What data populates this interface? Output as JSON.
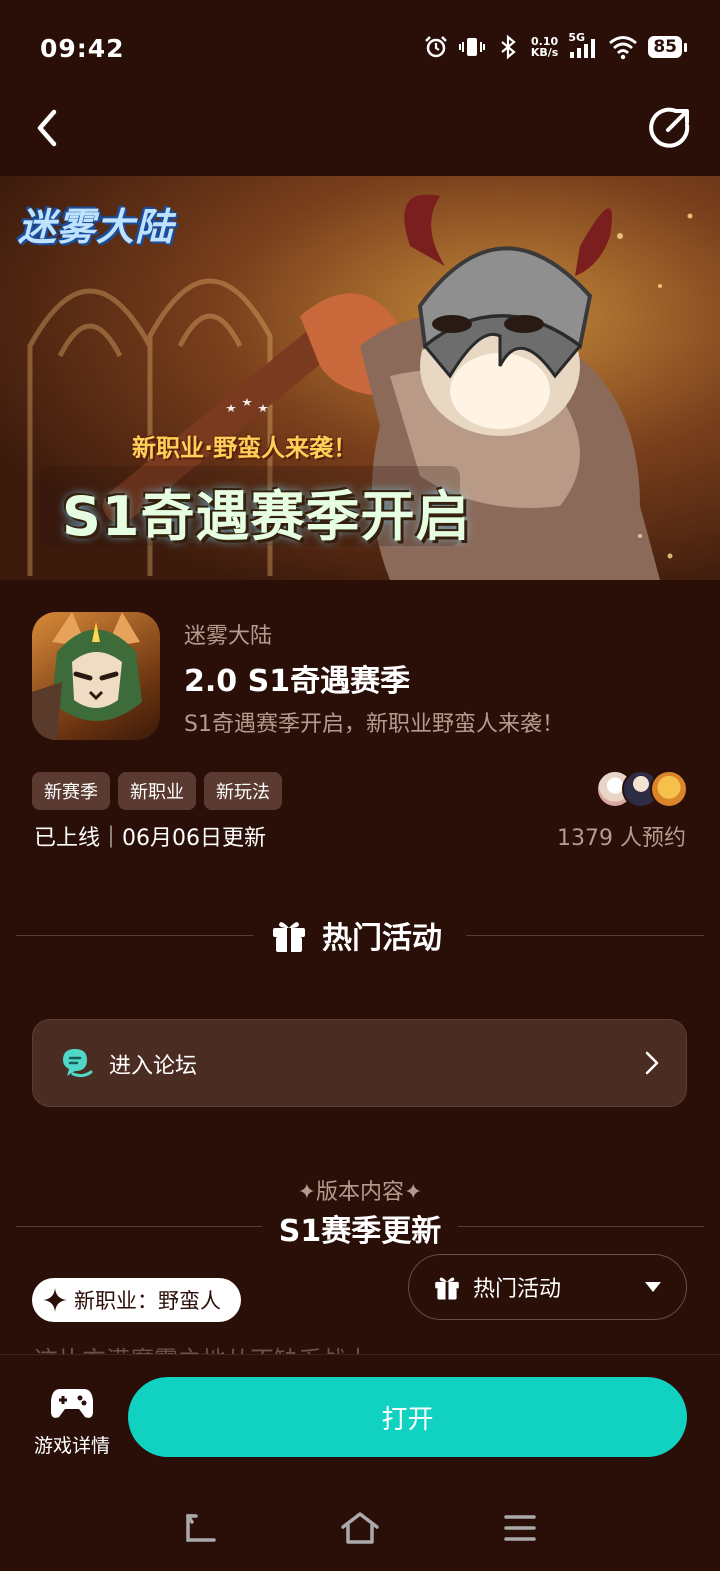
{
  "status_bar": {
    "time": "09:42",
    "net_speed_value": "0.10",
    "net_speed_unit": "KB/s",
    "network_type": "5G",
    "battery": "85"
  },
  "banner": {
    "logo_text": "迷雾大陆",
    "subtitle": "新职业·野蛮人来袭！",
    "title": "S1奇遇赛季开启"
  },
  "game": {
    "name": "迷雾大陆",
    "version_title": "2.0 S1奇遇赛季",
    "version_desc": "S1奇遇赛季开启，新职业野蛮人来袭！",
    "tags": [
      "新赛季",
      "新职业",
      "新玩法"
    ],
    "online_status": "已上线｜06月06日更新",
    "reservations": "1379 人预约"
  },
  "hot_activities": {
    "header": "热门活动",
    "forum_label": "进入论坛"
  },
  "version_content": {
    "kicker": "✦版本内容✦",
    "title": "S1赛季更新",
    "job_pill": "新职业：野蛮人",
    "dropdown_label": "热门活动",
    "peek_text": "这片充满魔雾之地从不缺乏战士"
  },
  "bottom": {
    "details_label": "游戏详情",
    "open_label": "打开",
    "accent_color": "#11d1c1"
  },
  "icons": [
    "alarm-icon",
    "vibrate-icon",
    "bluetooth-icon",
    "signal-icon",
    "wifi-icon",
    "back-icon",
    "share-icon",
    "gift-icon",
    "forum-chat-icon",
    "chevron-right-icon",
    "sparkle-icon",
    "caret-down-icon",
    "gamepad-icon"
  ]
}
